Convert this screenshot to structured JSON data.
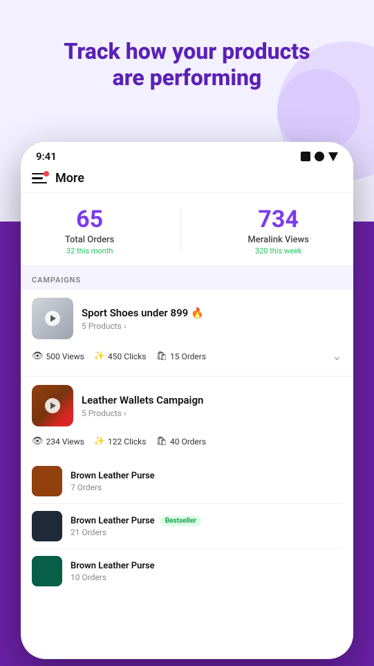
{
  "headline": {
    "line1": "Track how your products",
    "line2": "are performing"
  },
  "phone": {
    "statusBar": {
      "time": "9:41"
    },
    "nav": {
      "title": "More"
    },
    "stats": {
      "totalOrders": {
        "value": "65",
        "label": "Total Orders",
        "sub": "32 this month"
      },
      "meralinkViews": {
        "value": "734",
        "label": "Meralink Views",
        "sub": "320 this week"
      }
    },
    "campaignsLabel": "CAMPAIGNS",
    "campaigns": [
      {
        "id": "campaign-1",
        "name": "Sport Shoes under 899 🔥",
        "products": "5 Products",
        "views": "500 Views",
        "clicks": "450 Clicks",
        "orders": "15 Orders",
        "thumbType": "shoes",
        "expanded": false
      },
      {
        "id": "campaign-2",
        "name": "Leather Wallets Campaign",
        "products": "5 Products",
        "views": "234 Views",
        "clicks": "122 Clicks",
        "orders": "40 Orders",
        "thumbType": "leather",
        "expanded": true
      }
    ],
    "products": [
      {
        "name": "Brown Leather Purse",
        "orders": "7 Orders",
        "thumbColor": "brown",
        "bestseller": false
      },
      {
        "name": "Brown Leather Purse",
        "orders": "21 Orders",
        "thumbColor": "dark",
        "bestseller": true
      },
      {
        "name": "Brown Leather Purse",
        "orders": "10 Orders",
        "thumbColor": "green",
        "bestseller": false
      }
    ]
  },
  "labels": {
    "bestseller": "Bestseller"
  }
}
